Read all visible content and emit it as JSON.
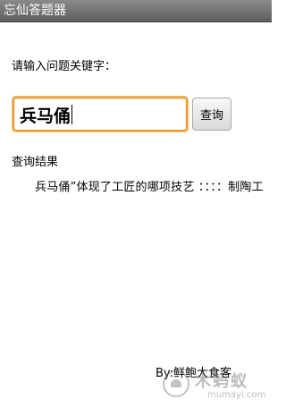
{
  "app": {
    "title": "忘仙答题器"
  },
  "search": {
    "prompt": "请输入问题关键字：",
    "value": "兵马俑",
    "button_label": "查询"
  },
  "results": {
    "label": "查询结果",
    "text": "兵马俑”体现了工匠的哪项技艺 ：：：：制陶工"
  },
  "footer": {
    "author": "By:鲜鲍大食客"
  },
  "watermark": {
    "cn": "木蚂蚁",
    "en": "mumayi.com"
  },
  "colors": {
    "focus_border": "#f39a2b",
    "titlebar": "#6e6e6e"
  }
}
